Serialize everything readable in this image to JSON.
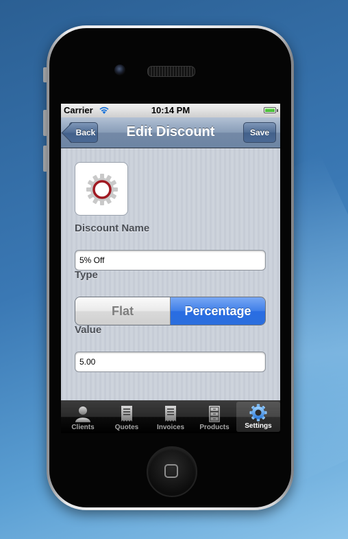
{
  "status_bar": {
    "carrier": "Carrier",
    "time": "10:14 PM"
  },
  "nav": {
    "back_label": "Back",
    "title": "Edit Discount",
    "save_label": "Save"
  },
  "form": {
    "discount_name_label": "Discount Name",
    "discount_name_value": "5% Off",
    "type_label": "Type",
    "type_options": [
      "Flat",
      "Percentage"
    ],
    "type_selected": "Percentage",
    "value_label": "Value",
    "value_value": "5.00"
  },
  "tabs": [
    {
      "label": "Clients",
      "icon": "person-icon",
      "selected": false
    },
    {
      "label": "Quotes",
      "icon": "receipt-icon",
      "selected": false
    },
    {
      "label": "Invoices",
      "icon": "receipt-icon",
      "selected": false
    },
    {
      "label": "Products",
      "icon": "cabinet-icon",
      "selected": false
    },
    {
      "label": "Settings",
      "icon": "gear-icon",
      "selected": true
    }
  ],
  "colors": {
    "nav_bar": "#7b8fab",
    "selected_segment": "#3a7be6",
    "gear_ring": "#a01a22",
    "selected_tab_icon": "#5fa8f0"
  }
}
